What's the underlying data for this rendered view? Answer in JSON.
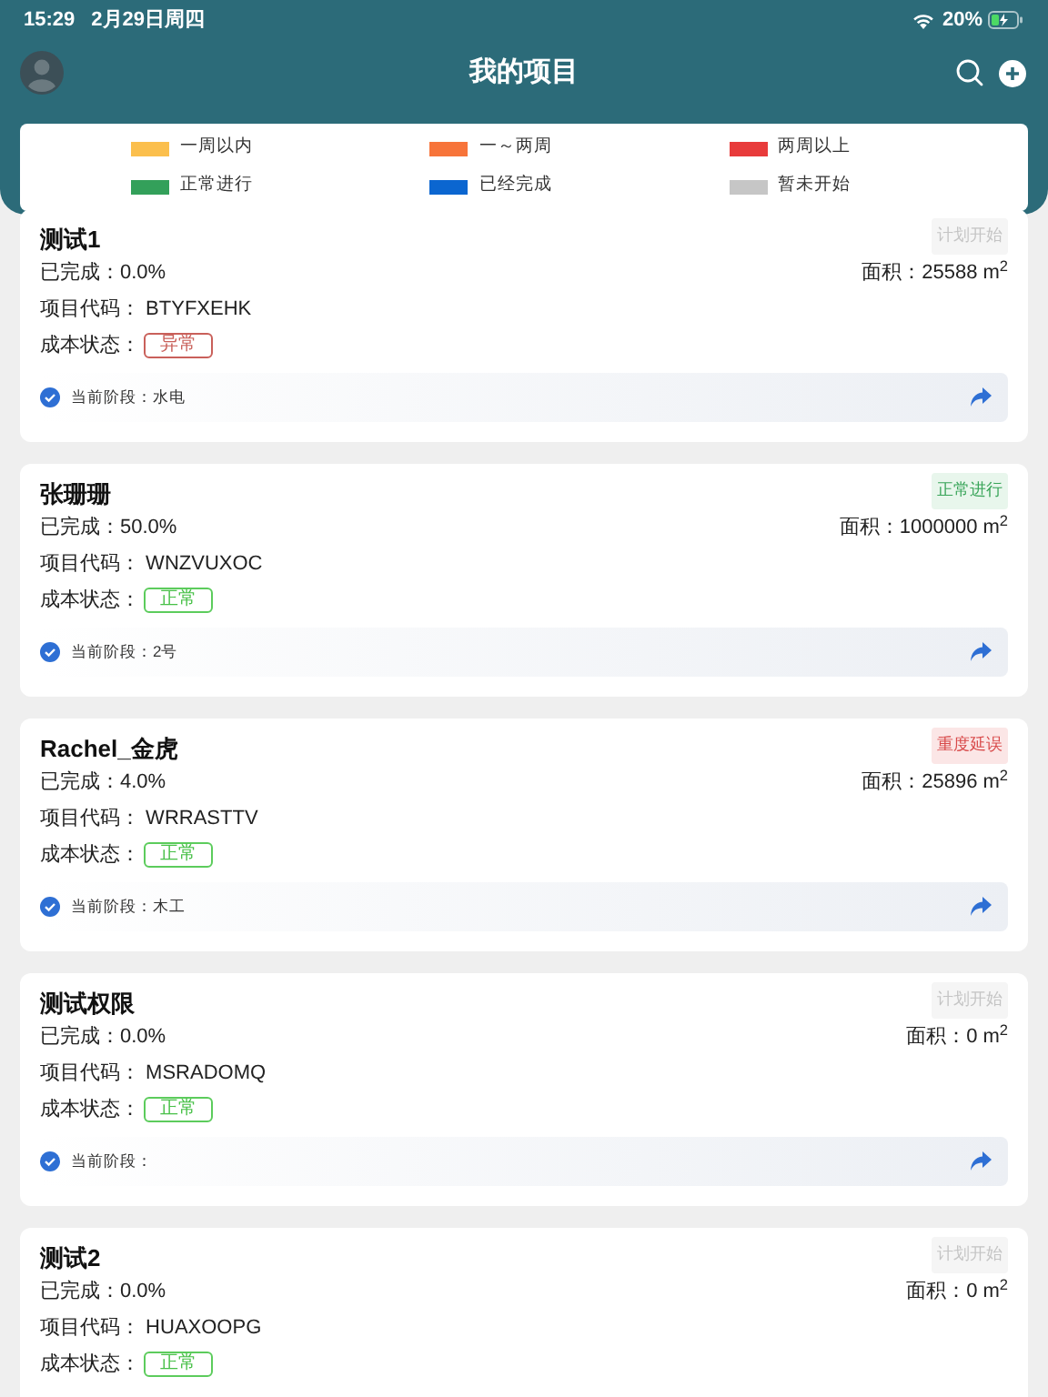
{
  "status_bar": {
    "time": "15:29",
    "date": "2月29日周四",
    "battery": "20%"
  },
  "header": {
    "title": "我的项目"
  },
  "legend": [
    {
      "label": "一周以内",
      "color": "#fbbf4d"
    },
    {
      "label": "一～两周",
      "color": "#f7743a"
    },
    {
      "label": "两周以上",
      "color": "#e83b3b"
    },
    {
      "label": "正常进行",
      "color": "#33a05a"
    },
    {
      "label": "已经完成",
      "color": "#0b66d0"
    },
    {
      "label": "暂未开始",
      "color": "#c6c6c6"
    }
  ],
  "projects": [
    {
      "name": "测试1",
      "status": {
        "kind": "planned",
        "label": "计划开始"
      },
      "progress": {
        "label": "已完成：",
        "value": "0.0%"
      },
      "area": {
        "label": "面积：",
        "value": "25588 m$^{2}$"
      },
      "code": {
        "label": "项目代码：",
        "value": "BTYFXEHK"
      },
      "cost": {
        "label": "成本状态：",
        "kind": "abnormal",
        "value": "异常"
      },
      "stage": {
        "label": "当前阶段：水电"
      }
    },
    {
      "name": "张珊珊",
      "status": {
        "kind": "normal",
        "label": "正常进行"
      },
      "progress": {
        "label": "已完成：",
        "value": "50.0%"
      },
      "area": {
        "label": "面积：",
        "value": "1000000 m$^{2}$"
      },
      "code": {
        "label": "项目代码：",
        "value": "WNZVUXOC"
      },
      "cost": {
        "label": "成本状态：",
        "kind": "normal",
        "value": "正常"
      },
      "stage": {
        "label": "当前阶段：2号"
      }
    },
    {
      "name": "Rachel_金虎",
      "status": {
        "kind": "delayed",
        "label": "重度延误"
      },
      "progress": {
        "label": "已完成：",
        "value": "4.0%"
      },
      "area": {
        "label": "面积：",
        "value": "25896 m$^{2}$"
      },
      "code": {
        "label": "项目代码：",
        "value": "WRRASTTV"
      },
      "cost": {
        "label": "成本状态：",
        "kind": "normal",
        "value": "正常"
      },
      "stage": {
        "label": "当前阶段：木工"
      }
    },
    {
      "name": "测试权限",
      "status": {
        "kind": "planned",
        "label": "计划开始"
      },
      "progress": {
        "label": "已完成：",
        "value": "0.0%"
      },
      "area": {
        "label": "面积：",
        "value": "0 m$^{2}$"
      },
      "code": {
        "label": "项目代码：",
        "value": "MSRADOMQ"
      },
      "cost": {
        "label": "成本状态：",
        "kind": "normal",
        "value": "正常"
      },
      "stage": {
        "label": "当前阶段："
      }
    },
    {
      "name": "测试2",
      "status": {
        "kind": "planned",
        "label": "计划开始"
      },
      "progress": {
        "label": "已完成：",
        "value": "0.0%"
      },
      "area": {
        "label": "面积：",
        "value": "0 m$^{2}$"
      },
      "code": {
        "label": "项目代码：",
        "value": "HUAXOOPG"
      },
      "cost": {
        "label": "成本状态：",
        "kind": "normal",
        "value": "正常"
      }
    }
  ]
}
